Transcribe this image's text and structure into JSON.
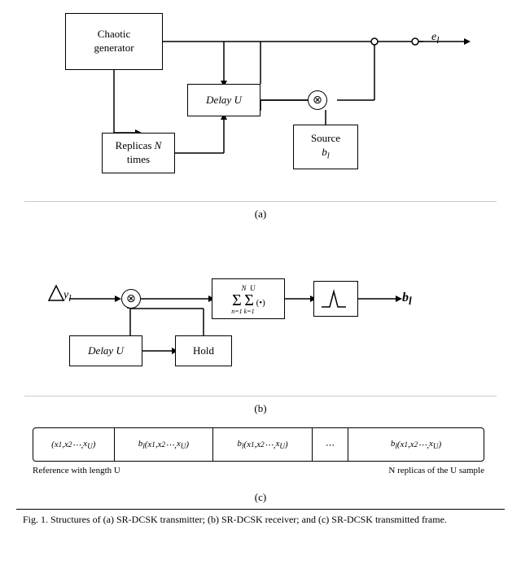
{
  "diagrams": {
    "a": {
      "chaotic_label": "Chaotic\ngenerator",
      "delay_label": "Delay U",
      "replicas_label": "Replicas N\ntimes",
      "source_label": "Source",
      "source_sub": "b",
      "source_subsub": "l",
      "e_label": "e",
      "e_sub": "l",
      "caption": "(a)"
    },
    "b": {
      "y_label": "y",
      "y_sub": "l",
      "delay_label": "Delay U",
      "hold_label": "Hold",
      "sum_top": "N",
      "sum_bottom_n": "n=1",
      "sum_top2": "U",
      "sum_bottom_k": "k=1",
      "sum_arg": "(•)",
      "b_label": "b",
      "b_sub": "l",
      "caption": "(b)"
    },
    "c": {
      "cell1": "(x₁, x₂ ⋯, xᵤ)",
      "cell2": "bₗ(x₁, x₂ ⋯, xᵤ)",
      "cell3": "bₗ(x₁, x₂ ⋯, xᵤ)",
      "cell4": "⋯",
      "cell5": "bₗ(x₁, x₂ ⋯, xᵤ)",
      "label_left": "Reference with length U",
      "label_right": "N replicas of the U sample",
      "caption": "(c)"
    }
  },
  "fig_caption": "Fig. 1. Structures of (a) SR-DCSK transmitter; (b) SR-DCSK receiver; and (c) SR-DCSK transmitted frame."
}
